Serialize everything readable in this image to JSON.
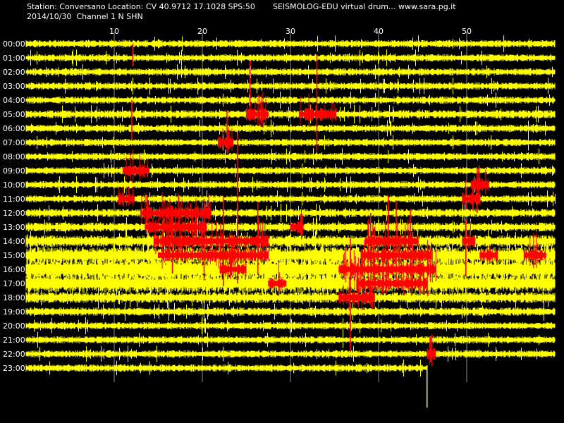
{
  "header": {
    "station_line": "Station: Conversano Location: CV 40.9712 17.1028 SPS:50",
    "date_line": "2014/10/30  Channel 1 N SHN",
    "site_line": "SEISMOLOG-EDU virtual drum... www.sara.pg.it"
  },
  "colors": {
    "background": "#000000",
    "trace_normal": "#ffff00",
    "trace_event": "#ff0000",
    "text": "#ffffff",
    "minute_grid": "#ffffff"
  },
  "chart_data": {
    "type": "line",
    "title": "",
    "xlabel": "",
    "ylabel": "",
    "x_range_minutes": [
      0,
      60
    ],
    "x_tick_labels": [
      "10",
      "20",
      "30",
      "40",
      "50"
    ],
    "x_tick_values": [
      10,
      20,
      30,
      40,
      50
    ],
    "row_labels": [
      "00:00",
      "01:00",
      "02:00",
      "03:00",
      "04:00",
      "05:00",
      "06:00",
      "07:00",
      "08:00",
      "09:00",
      "10:00",
      "11:00",
      "12:00",
      "13:00",
      "14:00",
      "15:00",
      "16:00",
      "17:00",
      "18:00",
      "19:00",
      "20:00",
      "21:00",
      "22:00",
      "23:00"
    ],
    "last_row_end_minute": 45.5,
    "noise_amplitude_by_row": [
      0.8,
      0.8,
      0.8,
      0.8,
      0.8,
      0.9,
      0.8,
      0.8,
      0.8,
      0.8,
      0.8,
      0.8,
      0.9,
      1.0,
      1.3,
      1.8,
      2.4,
      2.0,
      1.2,
      0.9,
      0.8,
      0.8,
      0.8,
      0.8
    ],
    "event_segments": [
      {
        "hour": 5,
        "start_minute": 25.0,
        "end_minute": 27.5
      },
      {
        "hour": 5,
        "start_minute": 31.0,
        "end_minute": 35.2
      },
      {
        "hour": 7,
        "start_minute": 21.8,
        "end_minute": 23.5
      },
      {
        "hour": 9,
        "start_minute": 11.0,
        "end_minute": 14.0
      },
      {
        "hour": 10,
        "start_minute": 50.5,
        "end_minute": 52.5
      },
      {
        "hour": 11,
        "start_minute": 10.5,
        "end_minute": 12.3
      },
      {
        "hour": 11,
        "start_minute": 49.5,
        "end_minute": 51.5
      },
      {
        "hour": 12,
        "start_minute": 13.0,
        "end_minute": 21.0
      },
      {
        "hour": 13,
        "start_minute": 13.5,
        "end_minute": 20.5
      },
      {
        "hour": 13,
        "start_minute": 30.0,
        "end_minute": 31.5
      },
      {
        "hour": 14,
        "start_minute": 14.5,
        "end_minute": 27.5
      },
      {
        "hour": 14,
        "start_minute": 38.5,
        "end_minute": 44.5
      },
      {
        "hour": 14,
        "start_minute": 49.5,
        "end_minute": 51.0
      },
      {
        "hour": 15,
        "start_minute": 15.0,
        "end_minute": 27.5
      },
      {
        "hour": 15,
        "start_minute": 38.0,
        "end_minute": 46.0
      },
      {
        "hour": 15,
        "start_minute": 51.5,
        "end_minute": 53.5
      },
      {
        "hour": 15,
        "start_minute": 56.5,
        "end_minute": 59.0
      },
      {
        "hour": 16,
        "start_minute": 22.0,
        "end_minute": 25.0
      },
      {
        "hour": 16,
        "start_minute": 35.5,
        "end_minute": 46.5
      },
      {
        "hour": 17,
        "start_minute": 27.5,
        "end_minute": 29.5
      },
      {
        "hour": 17,
        "start_minute": 37.5,
        "end_minute": 45.5
      },
      {
        "hour": 18,
        "start_minute": 35.5,
        "end_minute": 39.5
      },
      {
        "hour": 22,
        "start_minute": 45.5,
        "end_minute": 46.5
      }
    ],
    "event_spikes": [
      {
        "minute": 12.1,
        "from_hour": 0,
        "to_hour": 1.6
      },
      {
        "minute": 12.0,
        "from_hour": 4,
        "to_hour": 6.8
      },
      {
        "minute": 25.4,
        "from_hour": 1.2,
        "to_hour": 5.5
      },
      {
        "minute": 33.0,
        "from_hour": 0.8,
        "to_hour": 7.6
      },
      {
        "minute": 22.8,
        "from_hour": 4.7,
        "to_hour": 7.8
      },
      {
        "minute": 24.0,
        "from_hour": 6.3,
        "to_hour": 17.0
      },
      {
        "minute": 22.4,
        "from_hour": 10.8,
        "to_hour": 17.2
      },
      {
        "minute": 26.3,
        "from_hour": 11.2,
        "to_hour": 16.4
      },
      {
        "minute": 20.2,
        "from_hour": 11.0,
        "to_hour": 16.8
      },
      {
        "minute": 16.6,
        "from_hour": 11.5,
        "to_hour": 16.3
      },
      {
        "minute": 41.1,
        "from_hour": 10.8,
        "to_hour": 17.4
      },
      {
        "minute": 42.0,
        "from_hour": 11.2,
        "to_hour": 16.7
      },
      {
        "minute": 43.6,
        "from_hour": 11.8,
        "to_hour": 16.5
      },
      {
        "minute": 36.8,
        "from_hour": 13.8,
        "to_hour": 21.8
      },
      {
        "minute": 39.1,
        "from_hour": 12.0,
        "to_hour": 16.2
      },
      {
        "minute": 51.2,
        "from_hour": 8.8,
        "to_hour": 12.0
      },
      {
        "minute": 49.9,
        "from_hour": 12.5,
        "to_hour": 16.5
      },
      {
        "minute": 45.9,
        "from_hour": 20.8,
        "to_hour": 22.6
      }
    ]
  }
}
